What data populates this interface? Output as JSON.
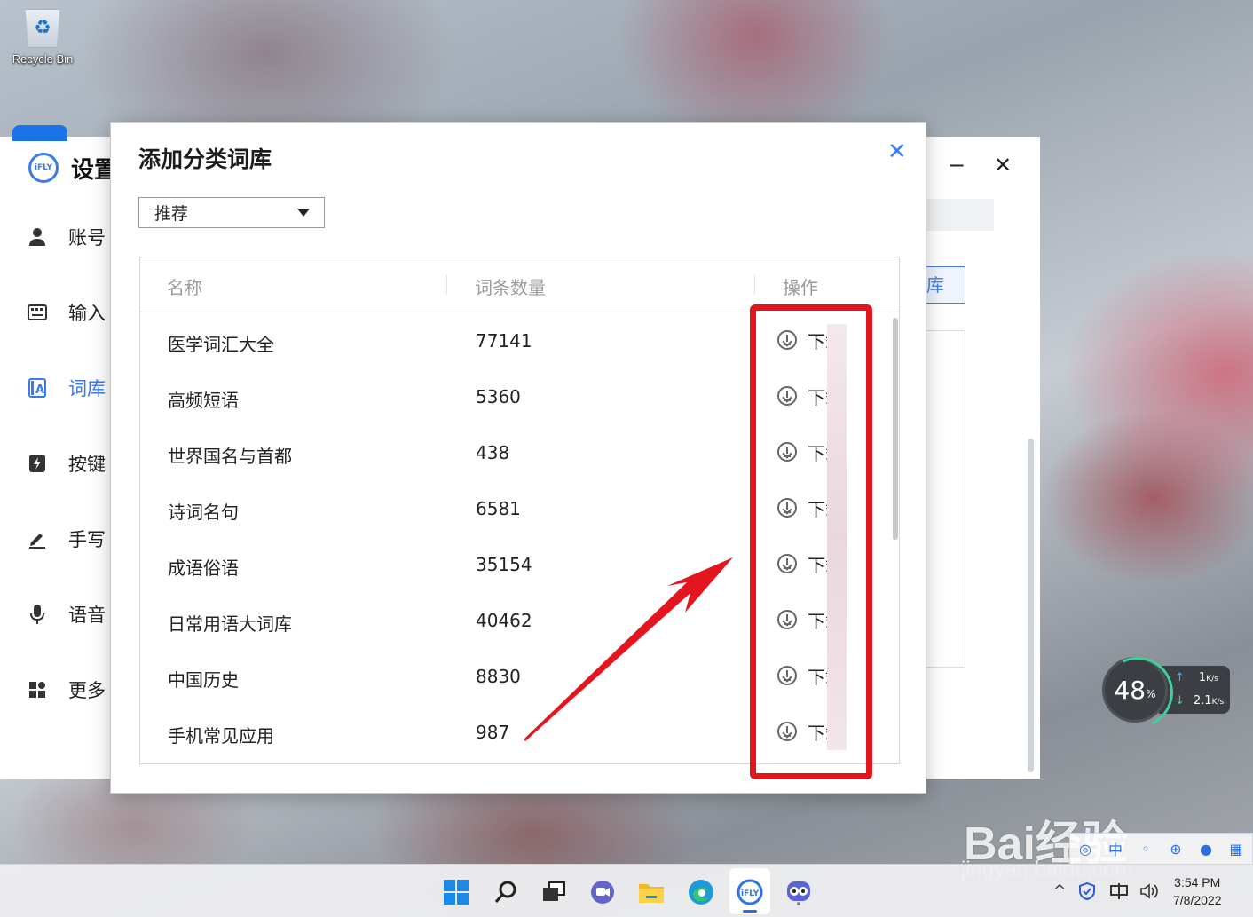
{
  "desktop": {
    "recycle_bin_label": "Recycle Bin"
  },
  "settings": {
    "title": "设置",
    "logo_text": "iFLY",
    "nav": [
      {
        "label": "账号",
        "icon": "user-icon"
      },
      {
        "label": "输入",
        "icon": "keyboard-icon"
      },
      {
        "label": "词库",
        "icon": "dictionary-icon"
      },
      {
        "label": "按键",
        "icon": "lightning-key-icon"
      },
      {
        "label": "手写",
        "icon": "pen-icon"
      },
      {
        "label": "语音",
        "icon": "microphone-icon"
      },
      {
        "label": "更多",
        "icon": "grid-icon"
      }
    ],
    "active_nav": "词库",
    "minimize": "−",
    "close": "✕",
    "right_button_partial": "库"
  },
  "dialog": {
    "title": "添加分类词库",
    "close": "✕",
    "category_select": {
      "value": "推荐"
    },
    "columns": [
      "名称",
      "词条数量",
      "操作"
    ],
    "rows": [
      {
        "name": "医学词汇大全",
        "count": "77141",
        "action": "下载"
      },
      {
        "name": "高频短语",
        "count": "5360",
        "action": "下载"
      },
      {
        "name": "世界国名与首都",
        "count": "438",
        "action": "下载"
      },
      {
        "name": "诗词名句",
        "count": "6581",
        "action": "下载"
      },
      {
        "name": "成语俗语",
        "count": "35154",
        "action": "下载"
      },
      {
        "name": "日常用语大词库",
        "count": "40462",
        "action": "下载"
      },
      {
        "name": "中国历史",
        "count": "8830",
        "action": "下载"
      },
      {
        "name": "手机常见应用",
        "count": "987",
        "action": "下载"
      }
    ]
  },
  "annotation": {
    "highlight_color": "#e3161f"
  },
  "speed_widget": {
    "percent": "48",
    "percent_unit": "%",
    "upload": "1",
    "upload_unit": "K/s",
    "download": "2.1",
    "download_unit": "K/s"
  },
  "watermark": {
    "brand": "Bai经验",
    "url": "jingyan.baidu.com"
  },
  "ime_toolbar": {
    "mode": "中"
  },
  "taskbar": {
    "icons": [
      "windows-start-icon",
      "search-icon",
      "task-view-icon",
      "teams-chat-icon",
      "file-explorer-icon",
      "edge-icon",
      "ifly-icon",
      "game-app-icon"
    ],
    "clock": {
      "time": "3:54 PM",
      "date": "7/8/2022"
    }
  }
}
